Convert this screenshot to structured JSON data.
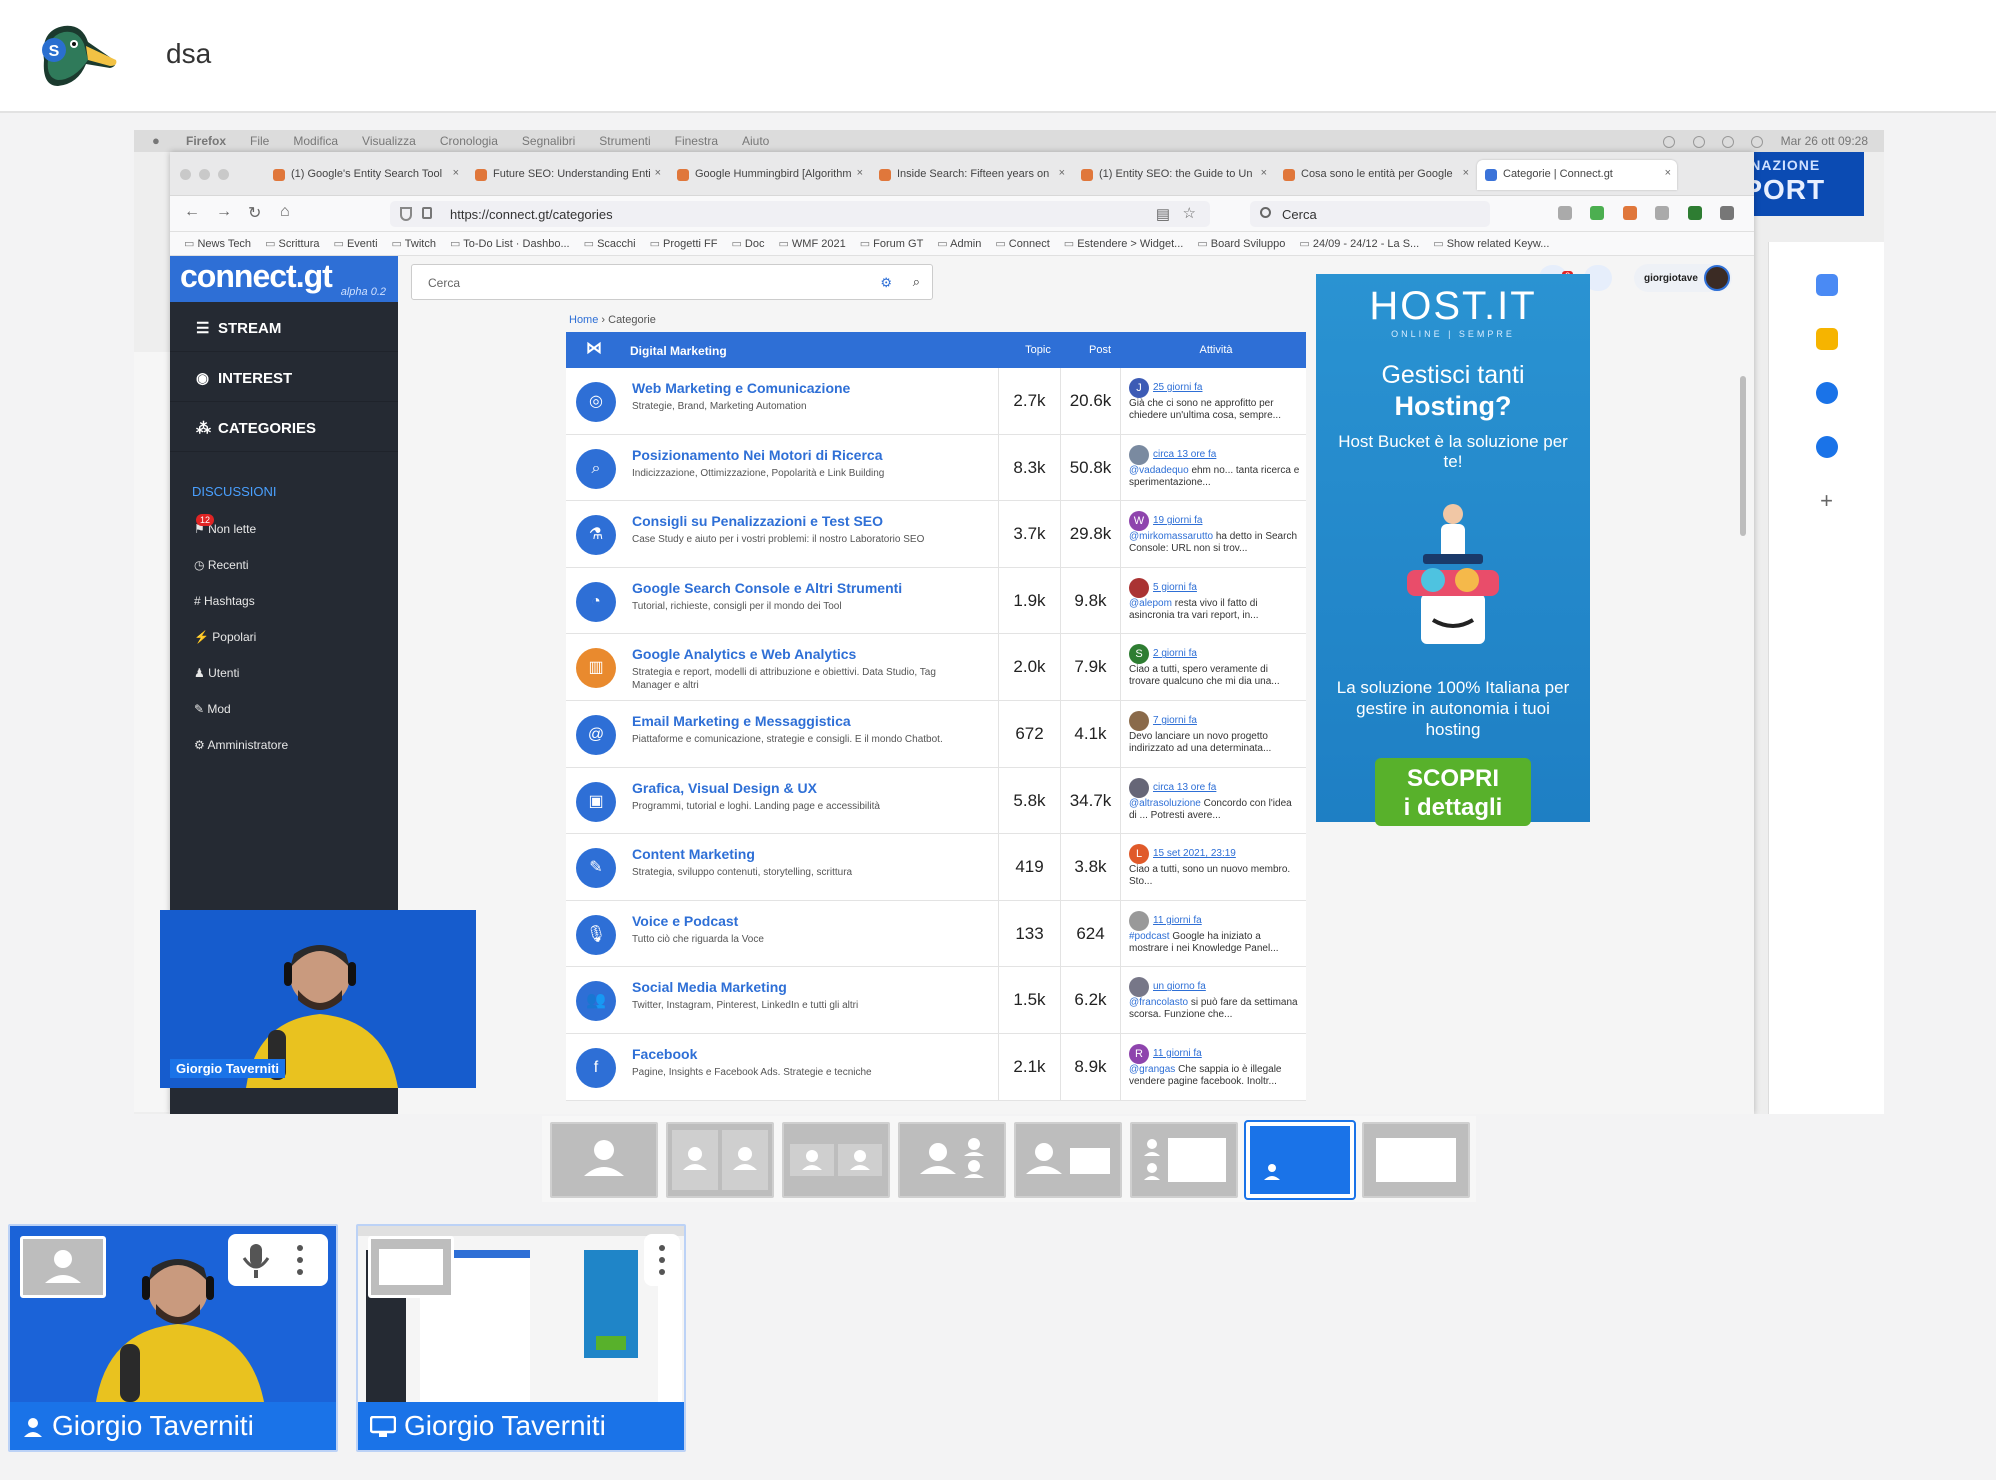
{
  "app": {
    "title": "dsa"
  },
  "mac_menubar": {
    "items": [
      "Firefox",
      "File",
      "Modifica",
      "Visualizza",
      "Cronologia",
      "Segnalibri",
      "Strumenti",
      "Finestra",
      "Aiuto"
    ],
    "clock": "Mar 26 ott 09:28"
  },
  "browser": {
    "tabs": [
      "(1) Google's Entity Search Tool",
      "Future SEO: Understanding Enti",
      "Google Hummingbird [Algorithm",
      "Inside Search: Fifteen years on",
      "(1) Entity SEO: the Guide to Un",
      "Cosa sono le entità per Google",
      "Categorie | Connect.gt"
    ],
    "url": "https://connect.gt/categories",
    "search_placeholder": "Cerca",
    "bookmarks": [
      "News Tech",
      "Scrittura",
      "Eventi",
      "Twitch",
      "To-Do List · Dashbo...",
      "Scacchi",
      "Progetti FF",
      "Doc",
      "WMF 2021",
      "Forum GT",
      "Admin",
      "Connect",
      "Estendere > Widget...",
      "Board Sviluppo",
      "24/09 - 24/12 - La S...",
      "Show related Keyw..."
    ],
    "background_promo": [
      "DESTINAZIONE",
      "EXPORT"
    ]
  },
  "site": {
    "logo": "connect.gt",
    "version": "alpha 0.2",
    "search_placeholder": "Cerca",
    "notifications": "2",
    "username": "giorgiotave",
    "nav": [
      "STREAM",
      "INTEREST",
      "CATEGORIES"
    ],
    "discussions_heading": "DISCUSSIONI",
    "discussion_links": [
      "Non lette",
      "Recenti",
      "Hashtags",
      "Popolari",
      "Utenti",
      "Mod",
      "Amministratore"
    ],
    "unread_badge": "12",
    "breadcrumb": {
      "home": "Home",
      "current": "Categorie"
    },
    "table": {
      "title": "Digital Marketing",
      "col_topic": "Topic",
      "col_post": "Post",
      "col_activity": "Attività",
      "rows": [
        {
          "name": "Web Marketing e Comunicazione",
          "desc": "Strategie, Brand, Marketing Automation",
          "topics": "2.7k",
          "posts": "20.6k",
          "avatar": "J",
          "avatar_color": "#3d5bb5",
          "when": "25 giorni fa",
          "who": "",
          "text": "Già che ci sono ne approfitto per chiedere un'ultima cosa, sempre...",
          "icon": "◎",
          "orange": false
        },
        {
          "name": "Posizionamento Nei Motori di Ricerca",
          "desc": "Indicizzazione, Ottimizzazione, Popolarità e Link Building",
          "topics": "8.3k",
          "posts": "50.8k",
          "avatar": "",
          "avatar_color": "#7a8aa0",
          "when": "circa 13 ore fa",
          "who": "@vadadequo",
          "text": "ehm no... tanta ricerca e sperimentazione...",
          "icon": "⌕",
          "orange": false
        },
        {
          "name": "Consigli su Penalizzazioni e Test SEO",
          "desc": "Case Study e aiuto per i vostri problemi: il nostro Laboratorio SEO",
          "topics": "3.7k",
          "posts": "29.8k",
          "avatar": "W",
          "avatar_color": "#8e44ad",
          "when": "19 giorni fa",
          "who": "@mirkomassarutto",
          "text": "ha detto in Search Console: URL non si trov...",
          "icon": "⚗",
          "orange": false
        },
        {
          "name": "Google Search Console e Altri Strumenti",
          "desc": "Tutorial, richieste, consigli per il mondo dei Tool",
          "topics": "1.9k",
          "posts": "9.8k",
          "avatar": "",
          "avatar_color": "#a33",
          "when": "5 giorni fa",
          "who": "@alepom",
          "text": "resta vivo il fatto di asincronia tra vari report, in...",
          "icon": "◔",
          "orange": false
        },
        {
          "name": "Google Analytics e Web Analytics",
          "desc": "Strategia e report, modelli di attribuzione e obiettivi. Data Studio, Tag Manager e altri",
          "topics": "2.0k",
          "posts": "7.9k",
          "avatar": "S",
          "avatar_color": "#2e7d32",
          "when": "2 giorni fa",
          "who": "",
          "text": "Ciao a tutti, spero veramente di trovare qualcuno che mi dia una...",
          "icon": "▥",
          "orange": true
        },
        {
          "name": "Email Marketing e Messaggistica",
          "desc": "Piattaforme e comunicazione, strategie e consigli. E il mondo Chatbot.",
          "topics": "672",
          "posts": "4.1k",
          "avatar": "",
          "avatar_color": "#8a6a4a",
          "when": "7 giorni fa",
          "who": "",
          "text": "Devo lanciare un novo progetto indirizzato ad una determinata...",
          "icon": "@",
          "orange": false
        },
        {
          "name": "Grafica, Visual Design & UX",
          "desc": "Programmi, tutorial e loghi. Landing page e accessibilità",
          "topics": "5.8k",
          "posts": "34.7k",
          "avatar": "",
          "avatar_color": "#667",
          "when": "circa 13 ore fa",
          "who": "@altrasoluzione",
          "text": "Concordo con l'idea di ... Potresti avere...",
          "icon": "▣",
          "orange": false
        },
        {
          "name": "Content Marketing",
          "desc": "Strategia, sviluppo contenuti, storytelling, scrittura",
          "topics": "419",
          "posts": "3.8k",
          "avatar": "L",
          "avatar_color": "#e05a2a",
          "when": "15 set 2021, 23:19",
          "who": "",
          "text": "Ciao a tutti, sono un nuovo membro. Sto...",
          "icon": "✎",
          "orange": false
        },
        {
          "name": "Voice e Podcast",
          "desc": "Tutto ciò che riguarda la Voce",
          "topics": "133",
          "posts": "624",
          "avatar": "",
          "avatar_color": "#999",
          "when": "11 giorni fa",
          "who": "#podcast",
          "text": "Google ha iniziato a mostrare i nei Knowledge Panel...",
          "icon": "🎙",
          "orange": false
        },
        {
          "name": "Social Media Marketing",
          "desc": "Twitter, Instagram, Pinterest, LinkedIn e tutti gli altri",
          "topics": "1.5k",
          "posts": "6.2k",
          "avatar": "",
          "avatar_color": "#778",
          "when": "un giorno fa",
          "who": "@francolasto",
          "text": "si può fare da settimana scorsa. Funzione che...",
          "icon": "👥",
          "orange": false
        },
        {
          "name": "Facebook",
          "desc": "Pagine, Insights e Facebook Ads. Strategie e tecniche",
          "topics": "2.1k",
          "posts": "8.9k",
          "avatar": "R",
          "avatar_color": "#8e44ad",
          "when": "11 giorni fa",
          "who": "@grangas",
          "text": "Che sappia io è illegale vendere pagine facebook. Inoltr...",
          "icon": "f",
          "orange": false
        }
      ]
    },
    "ad": {
      "logo": "HOST.IT",
      "tagline": "ONLINE | SEMPRE",
      "h1": "Gestisci tanti",
      "h2": "Hosting?",
      "p1": "Host Bucket è la soluzione per te!",
      "p2": "La soluzione 100% Italiana per gestire in autonomia i tuoi hosting",
      "cta_line1": "SCOPRI",
      "cta_line2": "i dettagli"
    }
  },
  "webcam_name": "Giorgio Taverniti",
  "participants": [
    {
      "name": "Giorgio Taverniti",
      "kind": "camera"
    },
    {
      "name": "Giorgio Taverniti",
      "kind": "screen"
    }
  ],
  "layout_options": [
    "single",
    "two-up",
    "two-grid",
    "one-plus-two",
    "person-plus-screen",
    "list-plus-screen",
    "screen-with-pip",
    "screen-only"
  ],
  "active_layout": "screen-with-pip",
  "colors": {
    "accent": "#1a73e8",
    "site_blue": "#2e6fd6",
    "sidebar": "#252a33",
    "ad_green": "#58b12b"
  }
}
